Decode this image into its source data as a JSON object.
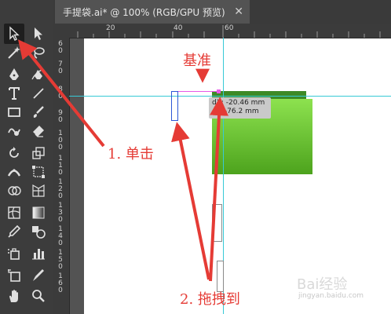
{
  "document_tab": {
    "title": "手提袋.ai* @ 100% (RGB/GPU 预览)",
    "close_glyph": "✕"
  },
  "ruler_top": [
    "20",
    "40",
    "60"
  ],
  "ruler_left": [
    "6\n0",
    "7\n0",
    "8\n0",
    "9\n0",
    "1\n0\n0",
    "1\n1\n0",
    "1\n2\n0",
    "1\n3\n0",
    "1\n4\n0",
    "1\n5\n0",
    "1\n6\n0"
  ],
  "measure_tooltip": {
    "dx_label": "dX:",
    "dx_value": "-20.46 mm",
    "dy_label": "dY:",
    "dy_value": "-76.2 mm"
  },
  "annotations": {
    "reference": "基准",
    "step1": "1. 单击",
    "step2": "2. 拖拽到"
  },
  "watermark": {
    "logo": "Bai经验",
    "url": "jingyan.baidu.com"
  },
  "colors": {
    "annotation_red": "#e53b35",
    "guide_cyan": "#37c9d6",
    "drag_magenta": "#e75ae7",
    "selection_blue": "#2d57d6",
    "green_top": "#8de24f",
    "green_bottom": "#4da31d"
  },
  "tools": [
    "selection-tool-icon",
    "direct-selection-tool-icon",
    "magic-wand-tool-icon",
    "lasso-tool-icon",
    "pen-tool-icon",
    "curvature-tool-icon",
    "type-tool-icon",
    "line-segment-tool-icon",
    "rectangle-tool-icon",
    "paintbrush-tool-icon",
    "shaper-tool-icon",
    "eraser-tool-icon",
    "rotate-tool-icon",
    "scale-tool-icon",
    "width-tool-icon",
    "free-transform-tool-icon",
    "shape-builder-tool-icon",
    "perspective-grid-tool-icon",
    "mesh-tool-icon",
    "gradient-tool-icon",
    "eyedropper-tool-icon",
    "blend-tool-icon",
    "symbol-sprayer-tool-icon",
    "column-graph-tool-icon",
    "artboard-tool-icon",
    "slice-tool-icon",
    "hand-tool-icon",
    "zoom-tool-icon"
  ]
}
